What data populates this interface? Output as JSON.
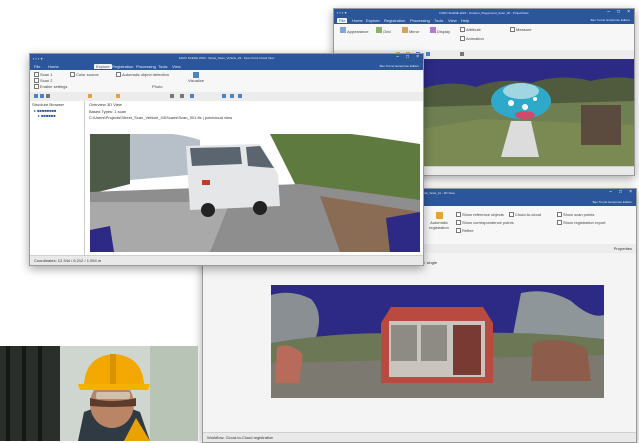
{
  "scan_windows": [
    {
      "title": "FARO SCENE 2023 - Outdoor_Playground_Scan_06 - ProjectView",
      "menu_tabs": [
        "File",
        "Home",
        "Explore",
        "Registration",
        "Processing",
        "Tools",
        "View",
        "Help"
      ],
      "user": "Ben Turner  Enterprise Edition",
      "ribbon_items": [
        "Appearance",
        "Grid",
        "Mirror",
        "Display",
        "Attribute",
        "Animation",
        "Measure"
      ],
      "panel_title": "Project Tree",
      "status": "Ready"
    },
    {
      "title": "FARO SCENE 2023 - Street_Scan_Vehicle_03 - Scan Point Cloud View",
      "menu_tabs": [
        "File",
        "Home",
        "Explore",
        "Registration",
        "Processing",
        "Tools",
        "View"
      ],
      "user": "Ben Turner  Enterprise Edition",
      "ribbon_items": [
        "Scan 1",
        "Scan 2",
        "Enable settings",
        "Color source",
        "Automatic object detection",
        "Photo",
        "Visualize"
      ],
      "panel_title": "Structure Browser",
      "view_tabs": [
        "Overview",
        "3D View"
      ],
      "scan_label": "Based Types: 1 scan",
      "path": "C:\\Users\\Projects\\Street_Scan_Vehicle_03\\Scans\\Scan_001.fls  |  pointcloud view",
      "status": "Coordinates: 12.344 / 8.212 / 1.054 m"
    },
    {
      "title": "FARO SCENE 2023 - Site_Kiosk_Scan_11 - 3D View",
      "user": "Ben Turner  Enterprise Edition",
      "ribbon_items": [
        "Automatic registration",
        "Show reference objects",
        "Show correspondence points",
        "Refine",
        "Cloud-to-cloud",
        "Show scan points",
        "Show registration report"
      ],
      "panel_title": "Properties",
      "scan_label": "Based Types: 1 scan",
      "path": "C:\\Users\\Projects\\Site_Kiosk_Scan_11\\Scans\\Scan_011.fls  |  points of scan point cloud, single",
      "status": "Workflow: Cloud-to-Cloud registration"
    }
  ],
  "colors": {
    "brand": "#2b579a",
    "void": "#2d2a86",
    "helmet": "#f2a800"
  }
}
